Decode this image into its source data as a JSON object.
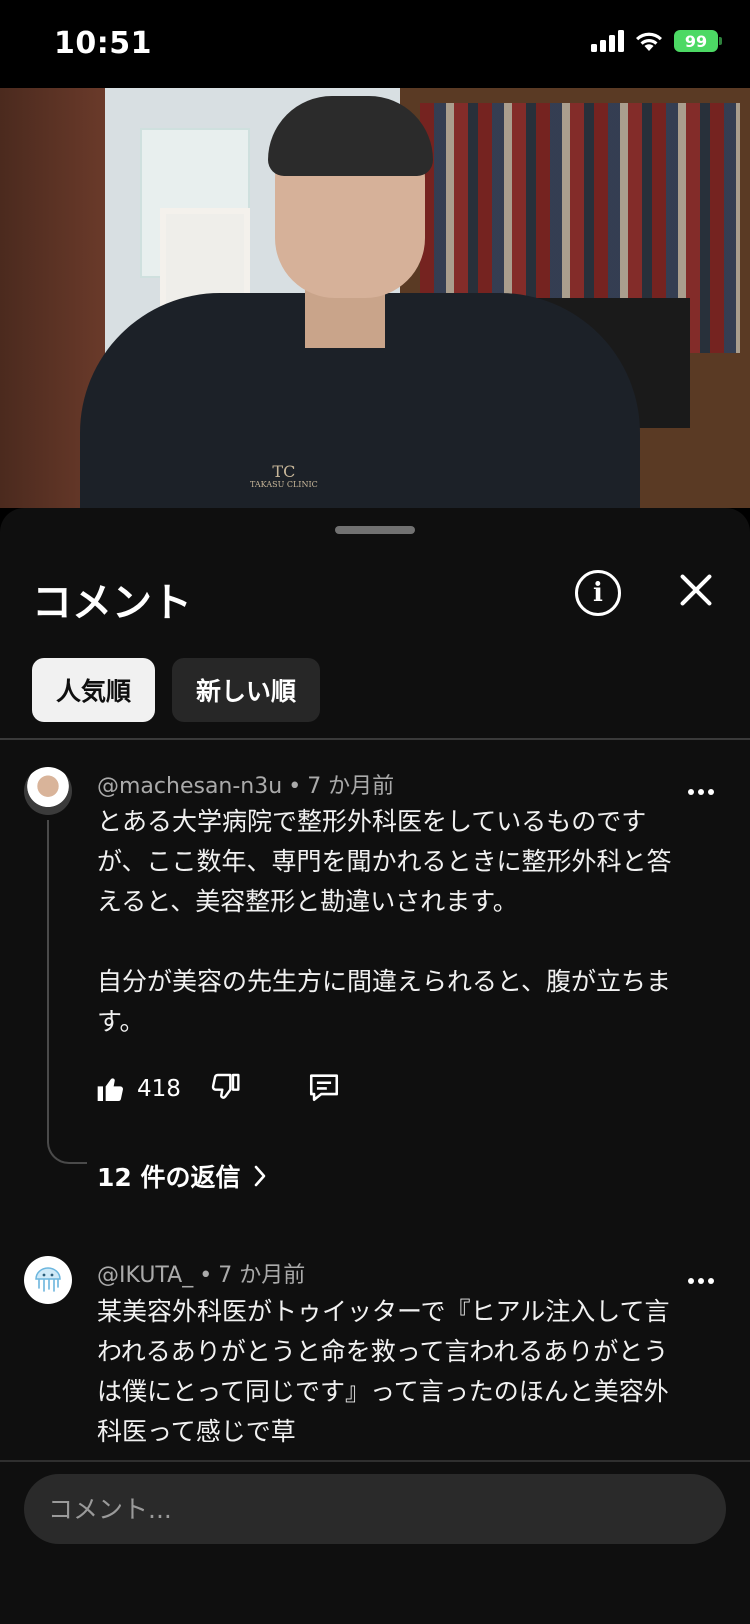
{
  "status_bar": {
    "time": "10:51",
    "battery": "99",
    "battery_color": "#4cd964"
  },
  "video": {
    "logo_text": "TC",
    "logo_sub": "TAKASU CLINIC"
  },
  "sheet": {
    "title": "コメント",
    "info_icon": "info-icon",
    "close_icon": "close-icon"
  },
  "sort_chips": [
    {
      "label": "人気順",
      "active": true
    },
    {
      "label": "新しい順",
      "active": false
    }
  ],
  "comments": [
    {
      "author": "@machesan-n3u",
      "time": "7 か月前",
      "text": "とある大学病院で整形外科医をしているものですが、ここ数年、専門を聞かれるときに整形外科と答えると、美容整形と勘違いされます。\n\n自分が美容の先生方に間違えられると、腹が立ちます。",
      "likes": "418",
      "replies_label": "12 件の返信"
    },
    {
      "author": "@IKUTA_",
      "time": "7 か月前",
      "text": "某美容外科医がトゥイッターで『ヒアル注入して言われるありがとうと命を救って言われるありがとうは僕にとって同じです』って言ったのほんと美容外科医って感じで草"
    }
  ],
  "input": {
    "placeholder": "コメント..."
  }
}
